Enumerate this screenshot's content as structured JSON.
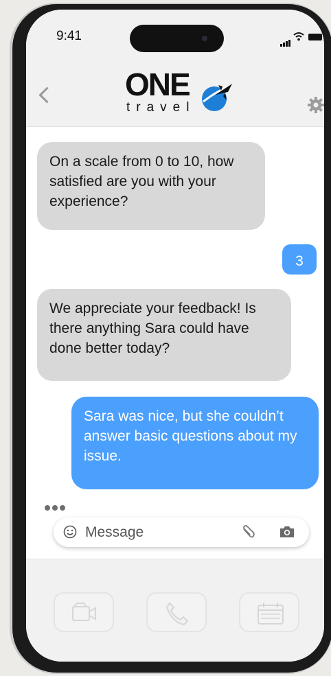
{
  "status_bar": {
    "time": "9:41"
  },
  "header": {
    "logo_word": "ONE",
    "logo_subword": "travel"
  },
  "messages": [
    {
      "from": "bot",
      "text": "On a scale from 0 to 10, how satisfied are you with your experience?"
    },
    {
      "from": "user",
      "text": "3"
    },
    {
      "from": "bot",
      "text": "We appreciate your feedback! Is there anything Sara could have done better today?"
    },
    {
      "from": "user",
      "text": "Sara was nice, but she couldn’t answer basic questions about my issue."
    }
  ],
  "composer": {
    "placeholder": "Message"
  },
  "icons": [
    "back-icon",
    "settings-gear-icon",
    "emoji-icon",
    "attachment-icon",
    "camera-icon",
    "video-call-icon",
    "phone-icon",
    "calendar-icon",
    "typing-indicator-icon"
  ],
  "colors": {
    "user_bubble": "#4b9ffd",
    "bot_bubble": "#d8d8d8",
    "logo_blue": "#1e7fd6"
  }
}
